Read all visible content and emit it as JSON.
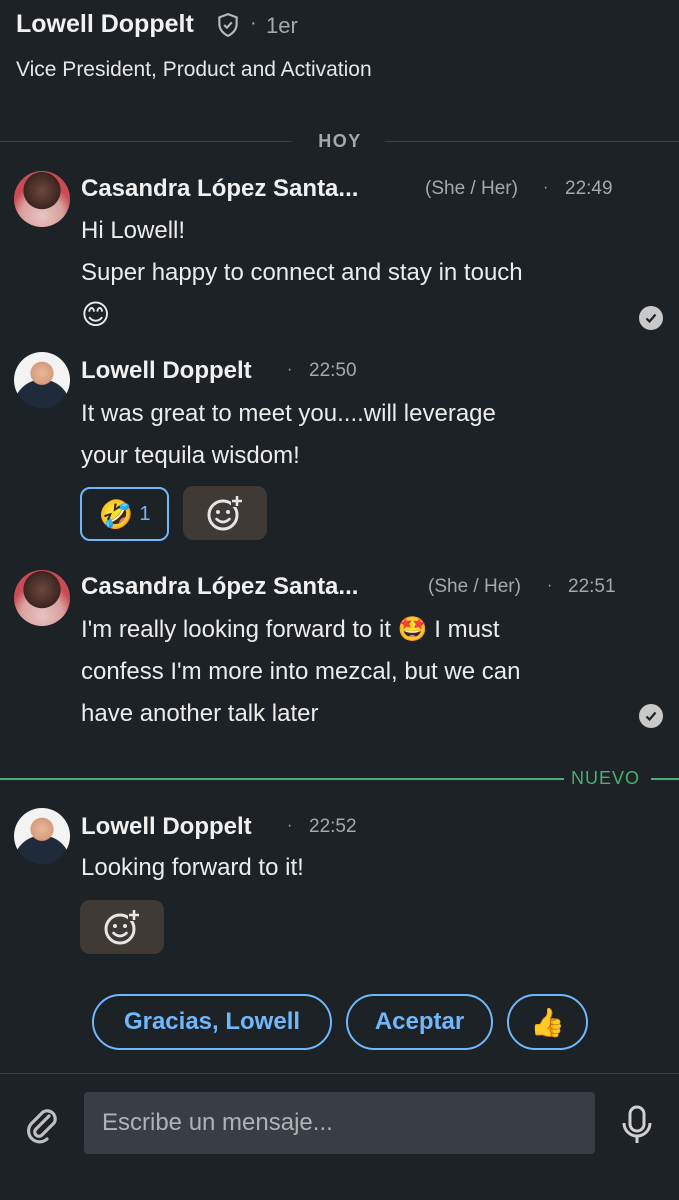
{
  "header": {
    "name": "Lowell Doppelt",
    "dot": "·",
    "degree": "1er",
    "subtitle": "Vice President, Product and Activation"
  },
  "date_divider": "HOY",
  "messages": [
    {
      "sender": "Casandra López Santa...",
      "pronouns": "(She / Her)",
      "dot": "·",
      "time": "22:49",
      "lines": [
        "Hi Lowell!",
        "Super happy to connect and stay in touch",
        "😊"
      ],
      "seen": true
    },
    {
      "sender": "Lowell Doppelt",
      "dot": "·",
      "time": "22:50",
      "lines": [
        "It was great to meet you....will leverage",
        "your tequila wisdom!"
      ],
      "reaction": {
        "emoji": "🤣",
        "count": "1"
      }
    },
    {
      "sender": "Casandra López Santa...",
      "pronouns": "(She / Her)",
      "dot": "·",
      "time": "22:51",
      "lines": [
        "I'm really looking forward to it 🤩 I must",
        "confess I'm more into mezcal, but we can",
        "have another talk later"
      ],
      "seen": true
    },
    {
      "sender": "Lowell Doppelt",
      "dot": "·",
      "time": "22:52",
      "lines": [
        "Looking forward to it!"
      ]
    }
  ],
  "new_divider": "NUEVO",
  "quick_replies": [
    "Gracias, Lowell",
    "Aceptar",
    "👍"
  ],
  "composer": {
    "placeholder": "Escribe un mensaje..."
  },
  "colors": {
    "background": "#1d2226",
    "accent_blue": "#71b7fb",
    "new_green": "#4cae70"
  },
  "icons": [
    "verified-shield-icon",
    "add-reaction-icon",
    "seen-check-icon",
    "paperclip-icon",
    "microphone-icon"
  ]
}
